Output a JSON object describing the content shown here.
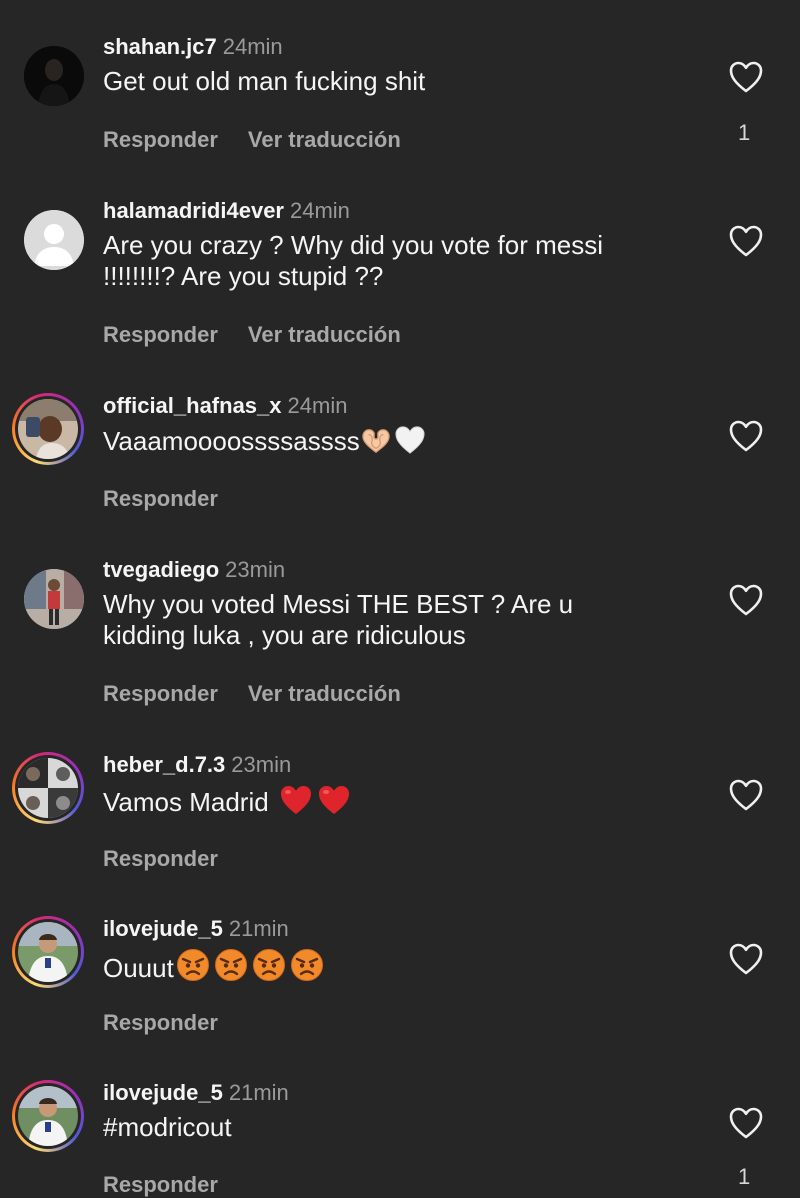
{
  "comments": [
    {
      "username": "shahan.jc7",
      "time": "24min",
      "text": "Get out old man fucking shit",
      "reply_label": "Responder",
      "translate_label": "Ver traducción",
      "likes": "1"
    },
    {
      "username": "halamadridi4ever",
      "time": "24min",
      "text": "Are you crazy ? Why did you vote for messi !!!!!!!!? Are you stupid ??",
      "reply_label": "Responder",
      "translate_label": "Ver traducción"
    },
    {
      "username": "official_hafnas_x",
      "time": "24min",
      "text": "Vaaamoooossssassss",
      "emojis": [
        "heart-hands",
        "white-heart"
      ],
      "reply_label": "Responder"
    },
    {
      "username": "tvegadiego",
      "time": "23min",
      "text": "Why you voted Messi THE BEST ? Are u kidding luka , you are ridiculous",
      "reply_label": "Responder",
      "translate_label": "Ver traducción"
    },
    {
      "username": "heber_d.7.3",
      "time": "23min",
      "text": "Vamos Madrid",
      "emojis": [
        "red-heart",
        "red-heart"
      ],
      "reply_label": "Responder"
    },
    {
      "username": "ilovejude_5",
      "time": "21min",
      "text": "Ouuut",
      "emojis": [
        "angry-face",
        "angry-face",
        "angry-face",
        "angry-face"
      ],
      "reply_label": "Responder"
    },
    {
      "username": "ilovejude_5",
      "time": "21min",
      "text": "#modricout",
      "reply_label": "Responder",
      "likes": "1"
    }
  ],
  "colors": {
    "background": "#262626",
    "primary_text": "#f5f5f5",
    "secondary_text": "#a8a8a8",
    "story_ring": [
      "#feda75",
      "#fa7e1e",
      "#d62976",
      "#962fbf",
      "#4f5bd5"
    ]
  },
  "icons": [
    "heart-outline-icon",
    "heart-hands-emoji",
    "white-heart-emoji",
    "red-heart-emoji",
    "angry-face-emoji"
  ]
}
